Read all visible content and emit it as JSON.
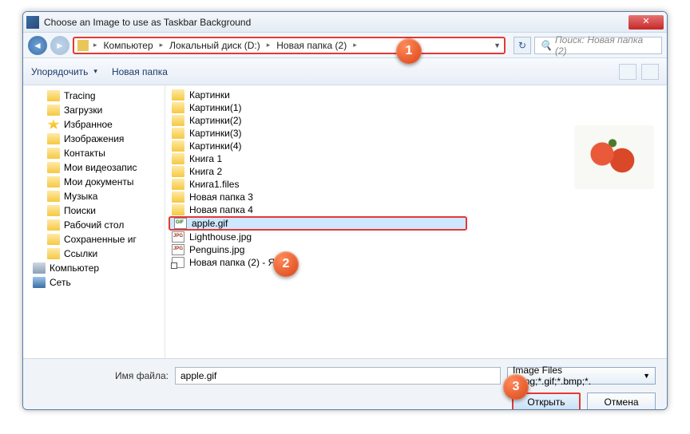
{
  "title": "Choose an Image to use as Taskbar Background",
  "breadcrumb": [
    "Компьютер",
    "Локальный диск (D:)",
    "Новая папка (2)"
  ],
  "search_placeholder": "Поиск: Новая папка (2)",
  "toolbar": {
    "organize": "Упорядочить",
    "newfolder": "Новая папка"
  },
  "tree": [
    {
      "label": "Tracing",
      "lvl": "l1",
      "ico": "fico"
    },
    {
      "label": "Загрузки",
      "lvl": "l1",
      "ico": "fico"
    },
    {
      "label": "Избранное",
      "lvl": "l1",
      "ico": "fico star"
    },
    {
      "label": "Изображения",
      "lvl": "l1",
      "ico": "fico"
    },
    {
      "label": "Контакты",
      "lvl": "l1",
      "ico": "fico"
    },
    {
      "label": "Мои видеозапис",
      "lvl": "l1",
      "ico": "fico"
    },
    {
      "label": "Мои документы",
      "lvl": "l1",
      "ico": "fico"
    },
    {
      "label": "Музыка",
      "lvl": "l1",
      "ico": "fico"
    },
    {
      "label": "Поиски",
      "lvl": "l1",
      "ico": "fico"
    },
    {
      "label": "Рабочий стол",
      "lvl": "l1",
      "ico": "fico"
    },
    {
      "label": "Сохраненные иг",
      "lvl": "l1",
      "ico": "fico"
    },
    {
      "label": "Ссылки",
      "lvl": "l1",
      "ico": "fico"
    },
    {
      "label": "Компьютер",
      "lvl": "l0",
      "ico": "fico comp"
    },
    {
      "label": "Сеть",
      "lvl": "l0",
      "ico": "fico net"
    }
  ],
  "files": [
    {
      "name": "Картинки",
      "type": "folder"
    },
    {
      "name": "Картинки(1)",
      "type": "folder"
    },
    {
      "name": "Картинки(2)",
      "type": "folder"
    },
    {
      "name": "Картинки(3)",
      "type": "folder"
    },
    {
      "name": "Картинки(4)",
      "type": "folder"
    },
    {
      "name": "Книга 1",
      "type": "folder"
    },
    {
      "name": "Книга 2",
      "type": "folder"
    },
    {
      "name": "Книга1.files",
      "type": "folder"
    },
    {
      "name": "Новая папка 3",
      "type": "folder"
    },
    {
      "name": "Новая папка 4",
      "type": "folder"
    },
    {
      "name": "apple.gif",
      "type": "gif",
      "selected": true
    },
    {
      "name": "Lighthouse.jpg",
      "type": "jpg"
    },
    {
      "name": "Penguins.jpg",
      "type": "jpg"
    },
    {
      "name": "Новая папка (2) - Ярлык",
      "type": "lnk"
    }
  ],
  "filename_label": "Имя файла:",
  "filename_value": "apple.gif",
  "filetype": "Image Files (*.jpg;*.gif;*.bmp;*.",
  "open_btn": "Открыть",
  "cancel_btn": "Отмена",
  "callouts": {
    "c1": "1",
    "c2": "2",
    "c3": "3"
  }
}
